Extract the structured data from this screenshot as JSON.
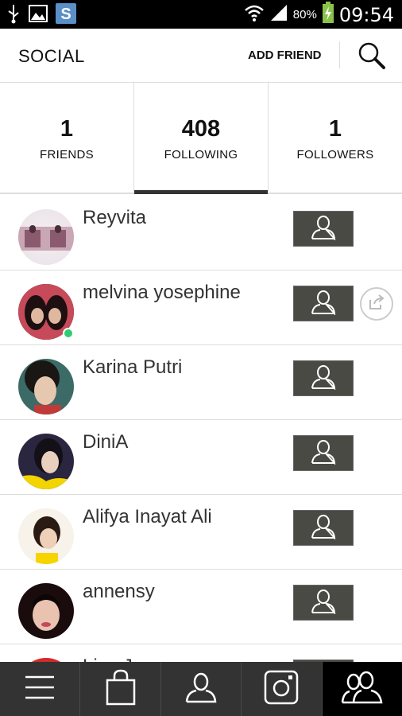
{
  "status_bar": {
    "battery_percent": "80%",
    "time": "09:54",
    "icons": [
      "usb-icon",
      "gallery-icon",
      "app-s-icon",
      "wifi-icon",
      "signal-icon",
      "battery-icon"
    ]
  },
  "header": {
    "title": "SOCIAL",
    "add_friend_label": "ADD FRIEND",
    "search_icon": "search-icon"
  },
  "stats": [
    {
      "count": "1",
      "label": "FRIENDS",
      "active": false
    },
    {
      "count": "408",
      "label": "FOLLOWING",
      "active": true
    },
    {
      "count": "1",
      "label": "FOLLOWERS",
      "active": false
    }
  ],
  "list": [
    {
      "name": "Reyvita",
      "online": false,
      "share": false
    },
    {
      "name": "melvina yosephine",
      "online": true,
      "share": true
    },
    {
      "name": "Karina Putri",
      "online": false,
      "share": false
    },
    {
      "name": "DiniA",
      "online": false,
      "share": false
    },
    {
      "name": "Alifya Inayat Ali",
      "online": false,
      "share": false
    },
    {
      "name": "annensy",
      "online": false,
      "share": false
    },
    {
      "name": "Lisa Joy",
      "online": false,
      "share": false
    }
  ],
  "bottom_nav": [
    {
      "icon": "menu-icon",
      "active": false
    },
    {
      "icon": "shopping-bag-icon",
      "active": false
    },
    {
      "icon": "profile-icon",
      "active": false
    },
    {
      "icon": "instagram-icon",
      "active": false
    },
    {
      "icon": "friends-icon",
      "active": true
    }
  ],
  "colors": {
    "accent_dark": "#333333",
    "follow_button": "#4a4a44",
    "online": "#2ecc71"
  }
}
